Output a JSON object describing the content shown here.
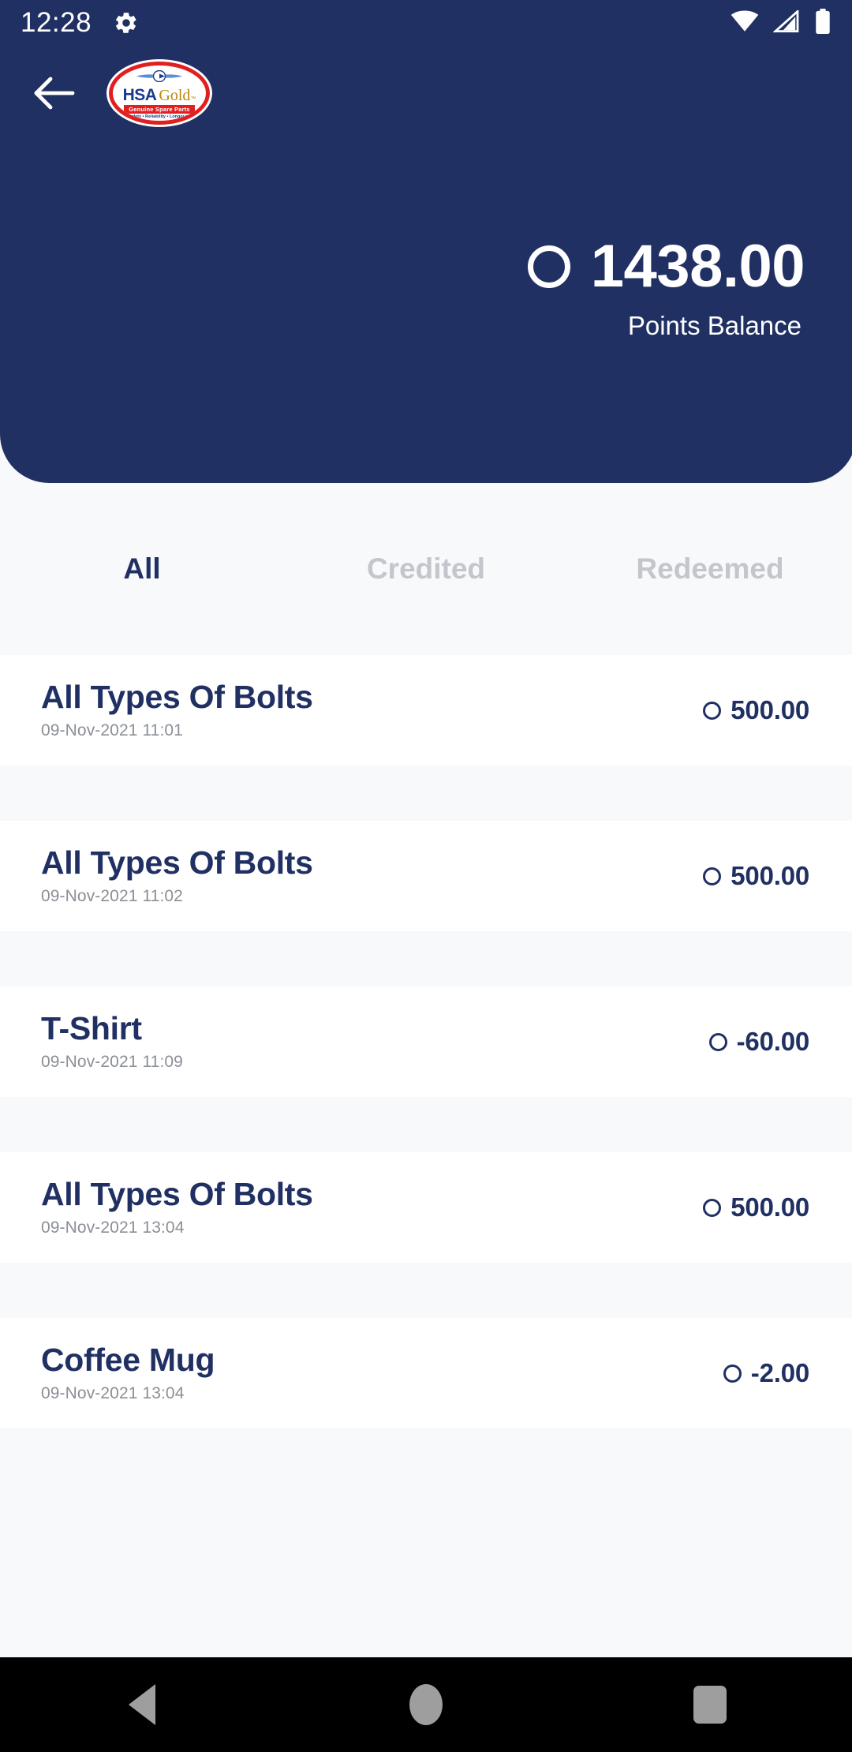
{
  "status_bar": {
    "time": "12:28",
    "gear_icon": "gear-icon",
    "wifi_icon": "wifi-icon",
    "signal_icon": "cellular-signal-icon",
    "battery_icon": "battery-full-icon"
  },
  "app_bar": {
    "back_icon": "back-arrow-icon",
    "logo": {
      "name": "hsa-gold-logo",
      "brand": "HSA",
      "sub_brand": "Gold",
      "trademark": "™",
      "banner": "Genuine Spare Parts",
      "tagline": "• Safety • Reliability • Longer Life"
    }
  },
  "balance": {
    "coin_icon": "points-coin-icon",
    "amount": "1438.00",
    "label": "Points Balance"
  },
  "tabs": [
    {
      "label": "All",
      "active": true
    },
    {
      "label": "Credited",
      "active": false
    },
    {
      "label": "Redeemed",
      "active": false
    }
  ],
  "transactions": [
    {
      "title": "All Types Of Bolts",
      "date": "09-Nov-2021 11:01",
      "amount": "500.00",
      "type": "credited"
    },
    {
      "title": "All Types Of Bolts",
      "date": "09-Nov-2021 11:02",
      "amount": "500.00",
      "type": "credited"
    },
    {
      "title": "T-Shirt",
      "date": "09-Nov-2021 11:09",
      "amount": "-60.00",
      "type": "redeemed"
    },
    {
      "title": "All Types Of Bolts",
      "date": "09-Nov-2021 13:04",
      "amount": "500.00",
      "type": "credited"
    },
    {
      "title": "Coffee Mug",
      "date": "09-Nov-2021 13:04",
      "amount": "-2.00",
      "type": "redeemed"
    }
  ],
  "nav_bar": {
    "back_icon": "nav-back-icon",
    "home_icon": "nav-home-icon",
    "recents_icon": "nav-recents-icon"
  },
  "colors": {
    "brand_navy": "#213063",
    "page_background": "#f8f9fa",
    "card_background": "#ffffff",
    "tab_inactive": "#c3c6cc",
    "date_text": "#8b8f96",
    "nav_bar_background": "#000000",
    "nav_icon": "#9e9e9e",
    "logo_red": "#e02020",
    "logo_gold": "#b8860b"
  }
}
